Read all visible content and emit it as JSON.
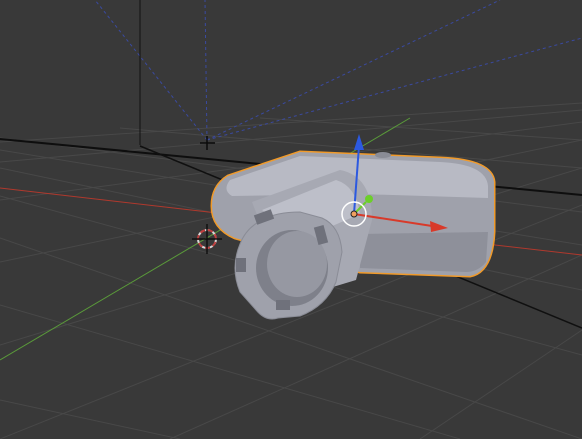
{
  "viewport": {
    "title": ""
  },
  "colors": {
    "background": "#393939",
    "grid_line": "#484848",
    "floor_edge": "#101010",
    "x_axis": "#b0392d",
    "y_axis": "#5a9a3a",
    "camera_frustum": "#3a4aa0",
    "selection_outline": "#f09a2a",
    "mesh_light": "#b4b6c0",
    "mesh_mid": "#9fa1ab",
    "mesh_dark": "#7e808a",
    "manipulator_x": "#d83a2a",
    "manipulator_y": "#6ccf2a",
    "manipulator_z": "#2c59e0",
    "origin_dot": "#f0a060"
  },
  "icons": {
    "cursor": "3d-cursor-icon",
    "manipulator": "transform-manipulator-icon",
    "camera": "camera-icon"
  }
}
